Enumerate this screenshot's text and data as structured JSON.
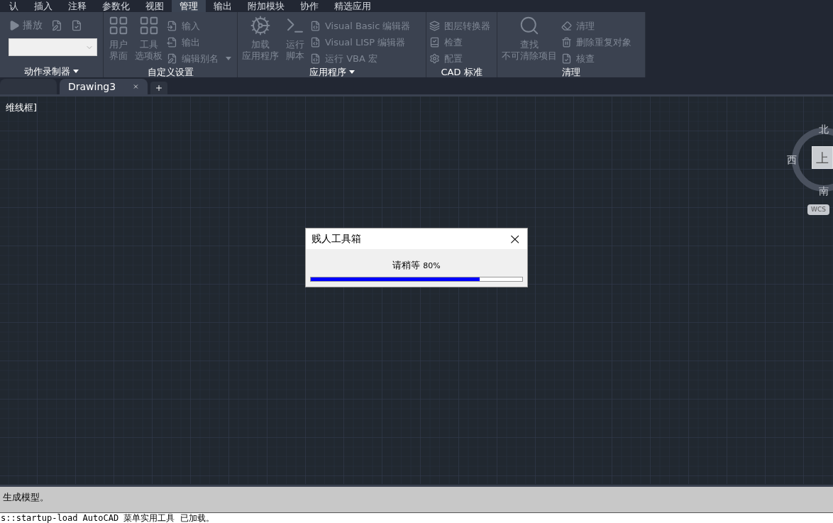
{
  "menu_tabs": [
    {
      "label": "认",
      "selected": false
    },
    {
      "label": "插入",
      "selected": false
    },
    {
      "label": "注释",
      "selected": false
    },
    {
      "label": "参数化",
      "selected": false
    },
    {
      "label": "视图",
      "selected": false
    },
    {
      "label": "管理",
      "selected": true
    },
    {
      "label": "输出",
      "selected": false
    },
    {
      "label": "附加模块",
      "selected": false
    },
    {
      "label": "协作",
      "selected": false
    },
    {
      "label": "精选应用",
      "selected": false
    }
  ],
  "ribbon": [
    {
      "title": "动作录制器",
      "has_menu": true,
      "items": [
        {
          "kind": "play",
          "label": "播放"
        },
        {
          "kind": "combo"
        }
      ]
    },
    {
      "title": "自定义设置",
      "has_menu": false,
      "items": [
        {
          "kind": "large",
          "lines": [
            "用户",
            "界面"
          ]
        },
        {
          "kind": "large",
          "lines": [
            "工具",
            "选项板"
          ]
        },
        {
          "kind": "small",
          "label": "输入",
          "has_menu": false
        },
        {
          "kind": "small",
          "label": "输出",
          "has_menu": false
        },
        {
          "kind": "small",
          "label": "编辑别名",
          "has_menu": true
        }
      ]
    },
    {
      "title": "应用程序",
      "has_menu": true,
      "items": [
        {
          "kind": "large",
          "lines": [
            "加载",
            "应用程序"
          ]
        },
        {
          "kind": "large",
          "lines": [
            "运行",
            "脚本"
          ]
        },
        {
          "kind": "small",
          "label": "Visual Basic 编辑器",
          "has_menu": false
        },
        {
          "kind": "small",
          "label": "Visual LISP 编辑器",
          "has_menu": false
        },
        {
          "kind": "small",
          "label": "运行 VBA 宏",
          "has_menu": false
        }
      ]
    },
    {
      "title": "CAD 标准",
      "has_menu": false,
      "items": [
        {
          "kind": "small",
          "label": "图层转换器",
          "has_menu": false
        },
        {
          "kind": "small",
          "label": "检查",
          "has_menu": false
        },
        {
          "kind": "small",
          "label": "配置",
          "has_menu": false
        }
      ]
    },
    {
      "title": "清理",
      "has_menu": false,
      "items": [
        {
          "kind": "large",
          "lines": [
            "查找",
            "不可清除项目"
          ]
        },
        {
          "kind": "small",
          "label": "清理",
          "has_menu": false
        },
        {
          "kind": "small",
          "label": "删除重复对象",
          "has_menu": false
        },
        {
          "kind": "small",
          "label": "核查",
          "has_menu": false
        }
      ]
    }
  ],
  "file_tabs": [
    {
      "selected": false
    },
    {
      "label": "Drawing3",
      "selected": true
    }
  ],
  "viewport_label": "维线框]",
  "viewcube": {
    "north": "北",
    "west": "西",
    "top": "上",
    "south": "南",
    "wcs": "WCS"
  },
  "dialog": {
    "title": "贱人工具箱",
    "close": "×",
    "message": "请稍等",
    "percent": "80%",
    "level": 0.8
  },
  "command_history": "生成模型。",
  "command_line": "s::startup-load AutoCAD 菜单实用工具 已加载。"
}
